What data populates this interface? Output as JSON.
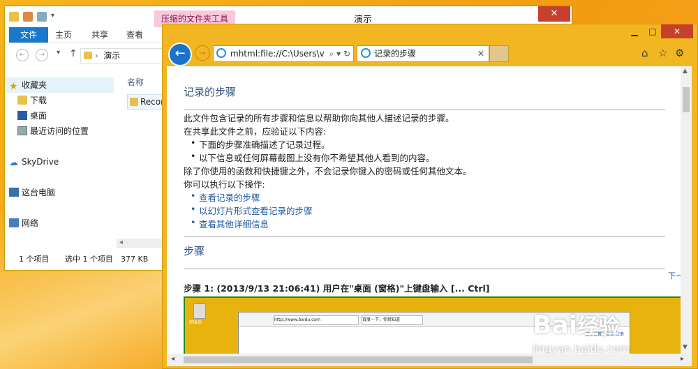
{
  "explorer": {
    "context_tab": "压缩的文件夹工具",
    "title": "演示",
    "ribbon": [
      "文件",
      "主页",
      "共享",
      "查看"
    ],
    "path": "演示",
    "nav": [
      {
        "label": "收藏夹",
        "icon": "star-icon"
      },
      {
        "label": "下载",
        "icon": "download-folder-icon"
      },
      {
        "label": "桌面",
        "icon": "desktop-icon"
      },
      {
        "label": "最近访问的位置",
        "icon": "recent-places-icon"
      },
      {
        "label": "SkyDrive",
        "icon": "cloud-icon"
      },
      {
        "label": "这台电脑",
        "icon": "computer-icon"
      },
      {
        "label": "网络",
        "icon": "network-icon"
      }
    ],
    "column_name": "名称",
    "file_name": "Recor",
    "status": {
      "count": "1 个项目",
      "selected": "选中 1 个项目",
      "size": "377 KB"
    }
  },
  "ie": {
    "address": "mhtml:file://C:\\Users\\v",
    "tab_title": "记录的步骤",
    "content": {
      "heading1": "记录的步骤",
      "p1": "此文件包含记录的所有步骤和信息以帮助你向其他人描述记录的步骤。",
      "p2": "在共享此文件之前，应验证以下内容:",
      "bullets": [
        "下面的步骤准确描述了记录过程。",
        "以下信息或任何屏幕截图上没有你不希望其他人看到的内容。"
      ],
      "p3": "除了你使用的函数和快捷键之外，不会记录你键入的密码或任何其他文本。",
      "p4": "你可以执行以下操作:",
      "links": [
        "查看记录的步骤",
        "以幻灯片形式查看记录的步骤",
        "查看其他详细信息"
      ],
      "heading2": "步骤",
      "next": "下一",
      "step": "步骤  1: (2013/9/13 21:06:41) 用户在\"桌面 (窗格)\"上键盘输入 [... Ctrl]",
      "shot": {
        "address": "http://www.baidu.com",
        "tab": "百度一下，你就知道",
        "links": "搜索设置 | 登录 注册",
        "bin_label": "回收站"
      }
    }
  },
  "watermark": {
    "logo": "Bai",
    "logo_cn": "经验",
    "url": "jingyan.baidu.com"
  },
  "colors": {
    "explorer_accent": "#1979ca",
    "ie_frame": "#f3b623",
    "close": "#c7402d",
    "link": "#1f5aa6"
  }
}
